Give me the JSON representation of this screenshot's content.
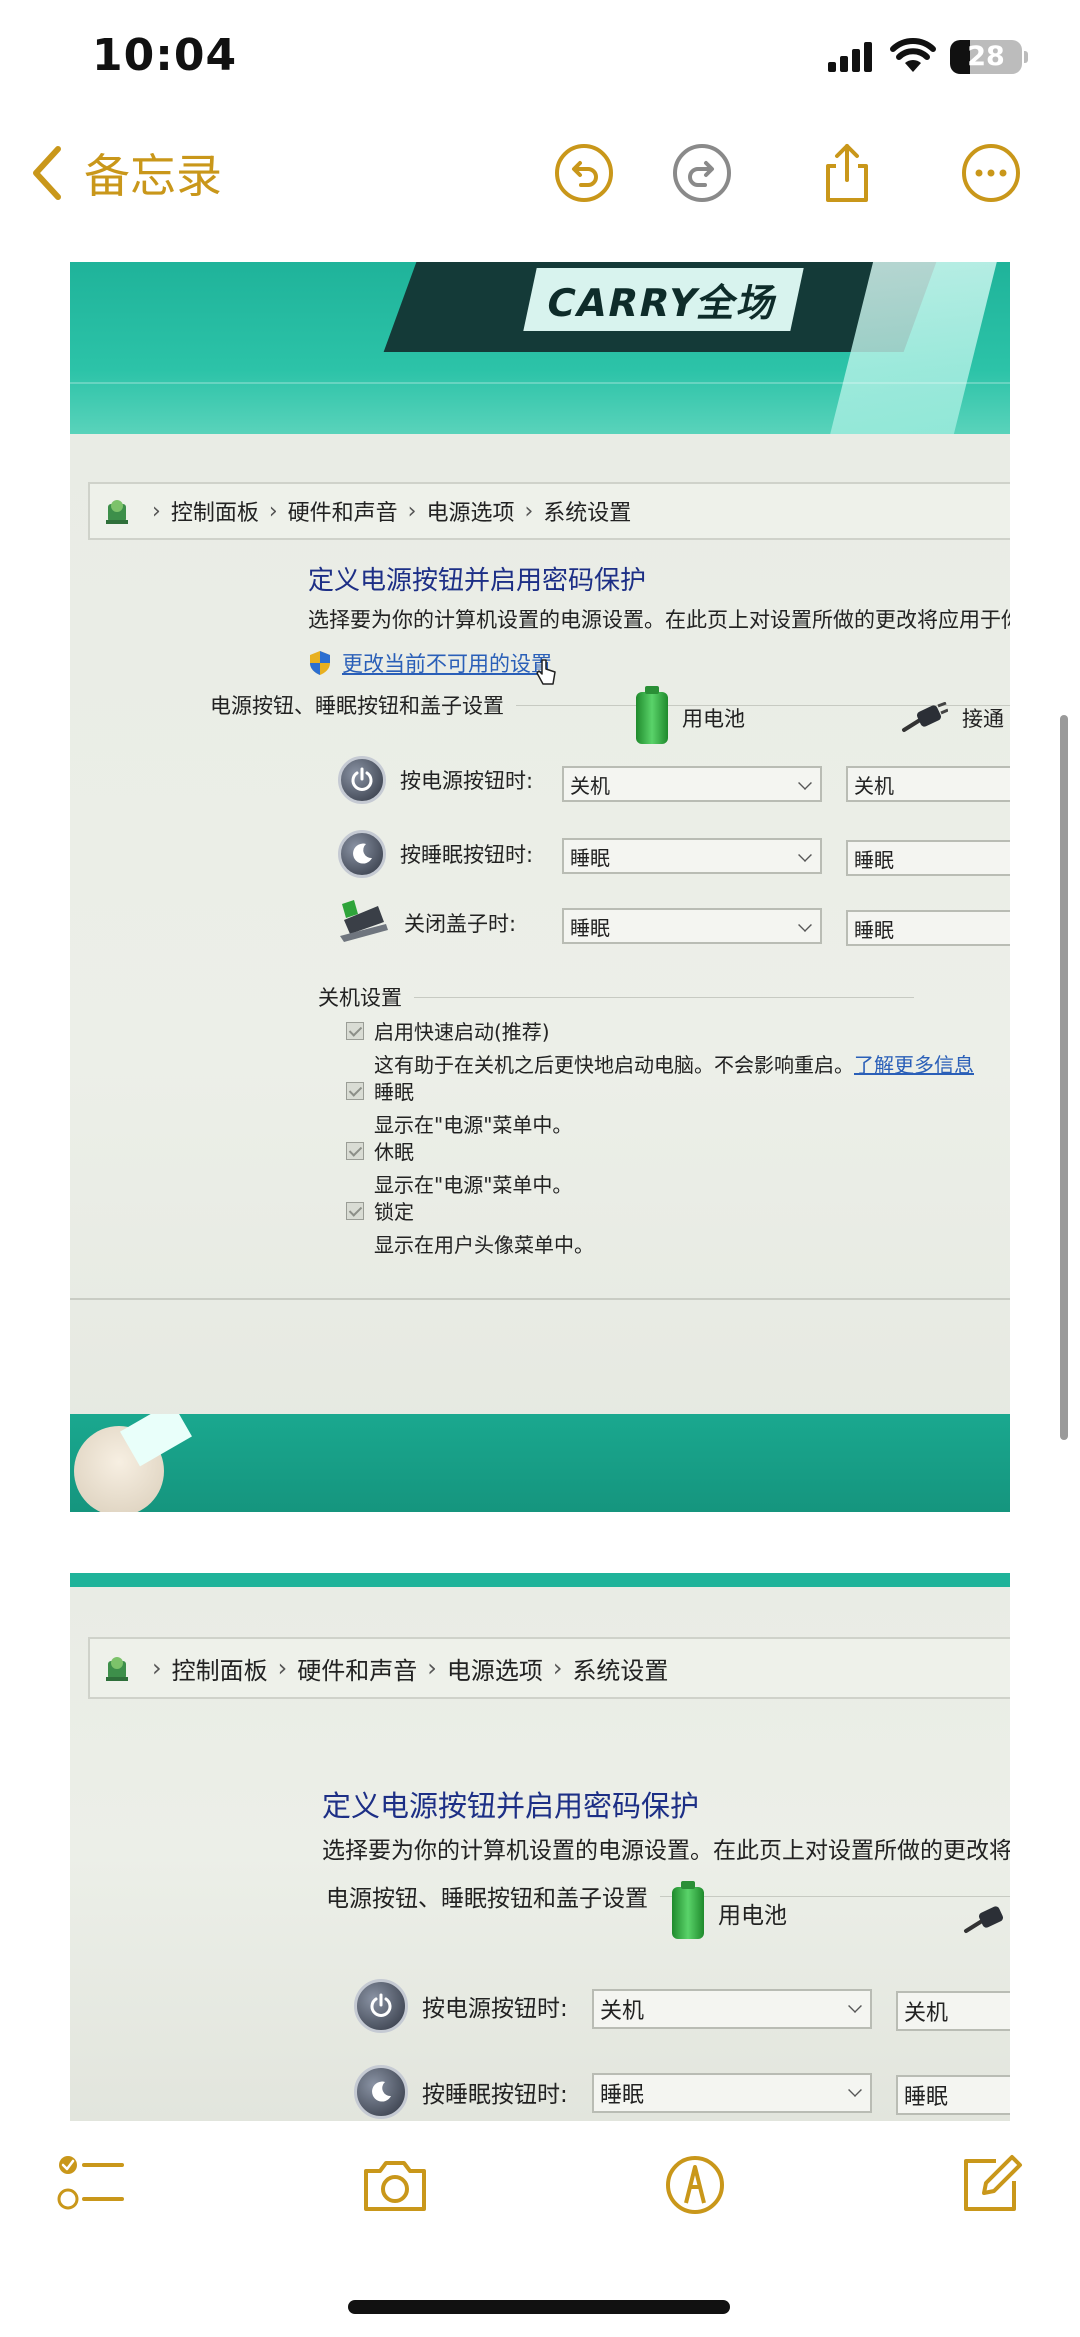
{
  "status_bar": {
    "time": "10:04",
    "battery_level": "28"
  },
  "nav": {
    "back_label": "备忘录",
    "accent_color": "#c9971a"
  },
  "photo1": {
    "banner_text": "CARRY全场",
    "breadcrumb": [
      "控制面板",
      "硬件和声音",
      "电源选项",
      "系统设置"
    ],
    "title": "定义电源按钮并启用密码保护",
    "description": "选择要为你的计算机设置的电源设置。在此页上对设置所做的更改将应用于你",
    "change_link": "更改当前不可用的设置",
    "group_label": "电源按钮、睡眠按钮和盖子设置",
    "col_battery": "用电池",
    "col_plugged": "接通",
    "rows": [
      {
        "label": "按电源按钮时:",
        "battery": "关机",
        "plugged": "关机"
      },
      {
        "label": "按睡眠按钮时:",
        "battery": "睡眠",
        "plugged": "睡眠"
      },
      {
        "label": "关闭盖子时:",
        "battery": "睡眠",
        "plugged": "睡眠"
      }
    ],
    "shutdown_label": "关机设置",
    "checkboxes": [
      {
        "label": "启用快速启动(推荐)",
        "desc": "这有助于在关机之后更快地启动电脑。不会影响重启。",
        "link": "了解更多信息"
      },
      {
        "label": "睡眠",
        "desc": "显示在\"电源\"菜单中。"
      },
      {
        "label": "休眠",
        "desc": "显示在\"电源\"菜单中。"
      },
      {
        "label": "锁定",
        "desc": "显示在用户头像菜单中。"
      }
    ]
  },
  "photo2": {
    "breadcrumb": [
      "控制面板",
      "硬件和声音",
      "电源选项",
      "系统设置"
    ],
    "title": "定义电源按钮并启用密码保护",
    "description": "选择要为你的计算机设置的电源设置。在此页上对设置所做的更改将应",
    "group_label": "电源按钮、睡眠按钮和盖子设置",
    "col_battery": "用电池",
    "rows": [
      {
        "label": "按电源按钮时:",
        "battery": "关机",
        "plugged": "关机"
      },
      {
        "label": "按睡眠按钮时:",
        "battery": "睡眠",
        "plugged": "睡眠"
      }
    ]
  }
}
